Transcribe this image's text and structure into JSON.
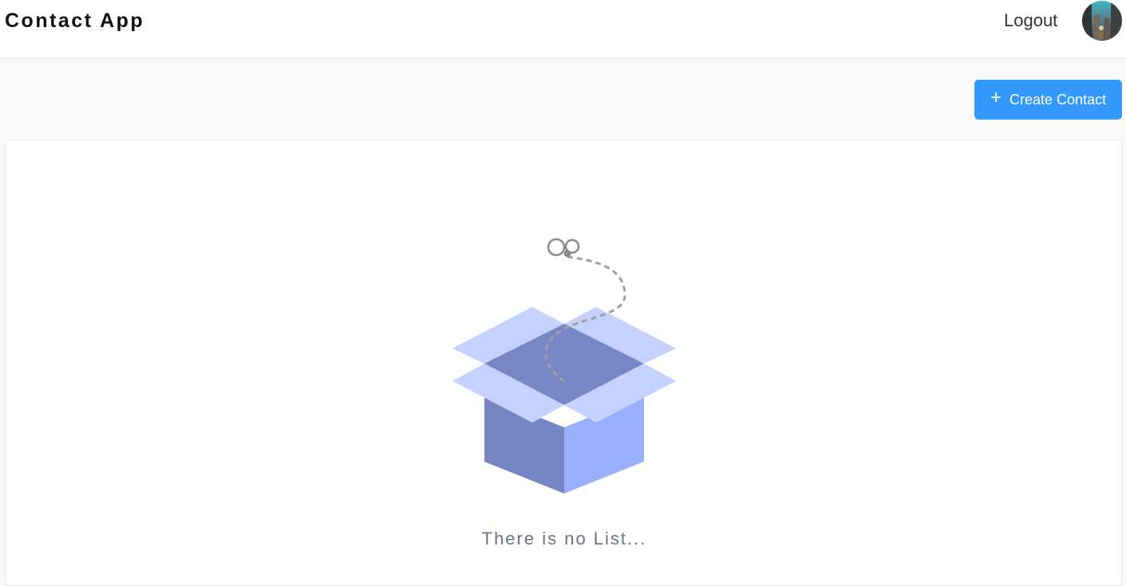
{
  "header": {
    "title": "Contact App",
    "logout_label": "Logout",
    "avatar_icon": "user-avatar"
  },
  "toolbar": {
    "create_label": "Create Contact",
    "create_icon": "plus-icon",
    "create_color": "#3399ff"
  },
  "empty_state": {
    "message": "There is no List...",
    "illustration": "empty-box-icon"
  }
}
